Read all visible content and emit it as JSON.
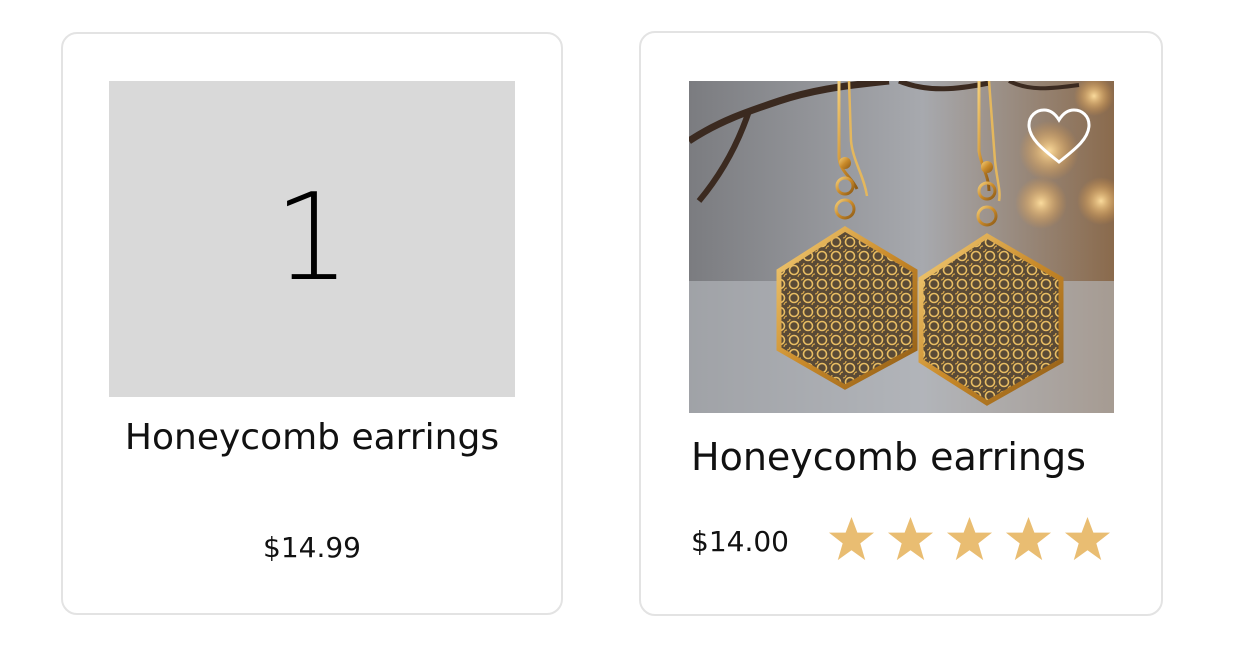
{
  "cards": [
    {
      "placeholder_number": "1",
      "title": "Honeycomb earrings",
      "price": "$14.99"
    },
    {
      "image_alt": "Gold hexagonal filigree earrings hanging from a branch",
      "title": "Honeycomb earrings",
      "price": "$14.00",
      "rating": 5,
      "rating_max": 5
    }
  ],
  "colors": {
    "star": "#e9bd72",
    "card_border": "#e3e3e3",
    "placeholder_bg": "#d9d9d9",
    "text": "#111111"
  },
  "icons": {
    "favorite": "heart-outline-icon",
    "rating": "star-icon"
  }
}
